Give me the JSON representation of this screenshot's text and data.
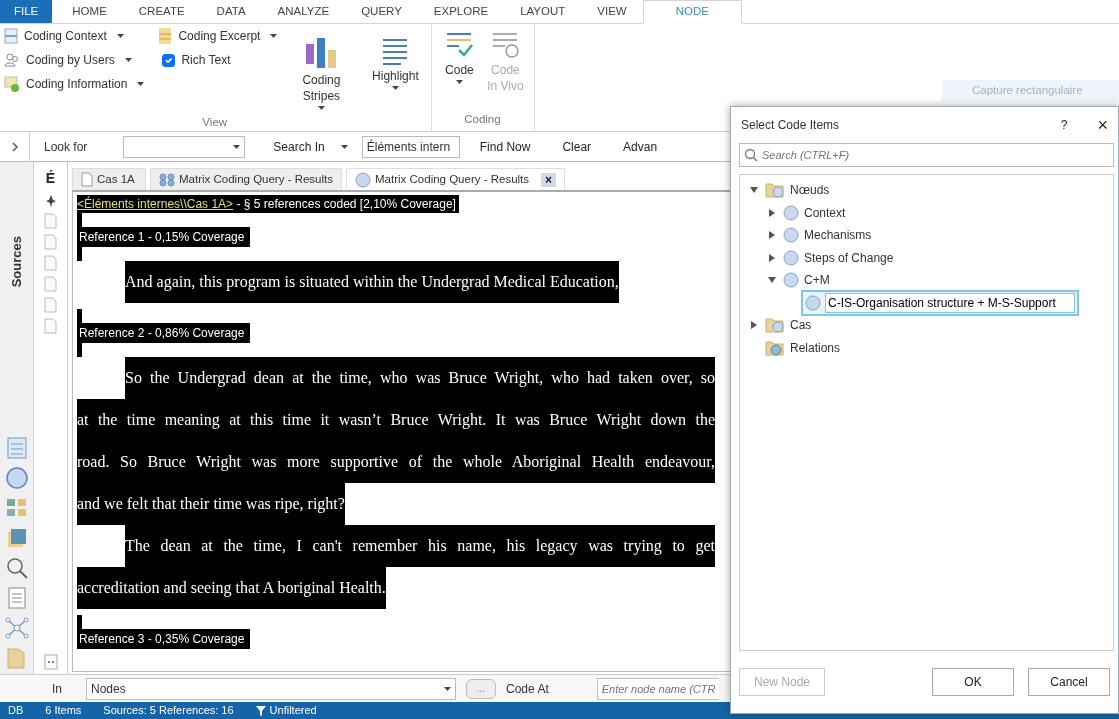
{
  "ribbon_tabs": [
    {
      "label": "FILE",
      "kind": "file",
      "selected": false
    },
    {
      "label": "HOME",
      "kind": "tab",
      "selected": false
    },
    {
      "label": "CREATE",
      "kind": "tab",
      "selected": false
    },
    {
      "label": "DATA",
      "kind": "tab",
      "selected": false
    },
    {
      "label": "ANALYZE",
      "kind": "tab",
      "selected": false
    },
    {
      "label": "QUERY",
      "kind": "tab",
      "selected": false
    },
    {
      "label": "EXPLORE",
      "kind": "tab",
      "selected": false
    },
    {
      "label": "LAYOUT",
      "kind": "tab",
      "selected": false
    },
    {
      "label": "VIEW",
      "kind": "tab",
      "selected": false
    },
    {
      "label": "NODE",
      "kind": "tab",
      "selected": true
    }
  ],
  "ribbon": {
    "view_group": {
      "label": "View",
      "small_items": [
        {
          "label": "Coding Context",
          "kind": "dropdown"
        },
        {
          "label": "Coding by Users",
          "kind": "dropdown"
        },
        {
          "label": "Coding Information",
          "kind": "dropdown"
        },
        {
          "label": "Coding Excerpt",
          "kind": "dropdown"
        },
        {
          "label": "Rich Text",
          "kind": "checkbox",
          "checked": true
        }
      ],
      "large_items": [
        {
          "label": "Coding Stripes",
          "kind": "dropdown"
        },
        {
          "label": "Highlight",
          "kind": "dropdown"
        }
      ]
    },
    "coding_group": {
      "label": "Coding",
      "large_items": [
        {
          "label": "Code",
          "kind": "dropdown",
          "disabled": false
        },
        {
          "label": "Code In Vivo",
          "kind": "button",
          "disabled": true
        }
      ]
    }
  },
  "capture_hint": "Capture rectangulaire",
  "find_bar": {
    "look_for": "Look for",
    "search_in": "Search In",
    "search_in_value": "Éléments intern",
    "buttons": [
      "Find Now",
      "Clear",
      "Advan"
    ]
  },
  "sidebar": {
    "label": "Sources"
  },
  "list_header": "É",
  "doc_tabs": [
    {
      "label": "Cas 1A",
      "selected": false
    },
    {
      "label": "Matrix Coding Query - Results",
      "selected": false
    },
    {
      "label": "Matrix Coding Query - Results",
      "selected": true,
      "close": "×"
    }
  ],
  "document": {
    "source_link": "<Éléments internes\\\\Cas 1A>",
    "summary": " - § 5 references coded  [2,10% Coverage]",
    "references": [
      {
        "label": "Reference 1 - 0,15% Coverage",
        "paragraphs": [
          {
            "lines": [
              "And again, this program is situated within the Undergrad Medical Education,"
            ]
          }
        ]
      },
      {
        "label": "Reference 2 - 0,86% Coverage",
        "paragraphs": [
          {
            "lines": [
              "So the Undergrad dean at the time, who was Bruce Wright, who had taken over, so",
              "at the time meaning at this time it wasn’t Bruce Wright. It was Bruce Wright down the",
              "road. So Bruce Wright was more supportive of the whole Aboriginal Health endeavour,",
              "and we felt that their time was ripe, right?"
            ]
          },
          {
            "lines": [
              "The dean at the time, I can't remember his name, his legacy was trying to get",
              "accreditation and seeing that A boriginal Health."
            ]
          }
        ]
      },
      {
        "label": "Reference 3 - 0,35% Coverage"
      }
    ]
  },
  "code_bar": {
    "in_label": "In",
    "in_value": "Nodes",
    "browse": "...",
    "code_at": "Code At",
    "placeholder": "Enter node name (CTR"
  },
  "status_bar": [
    "DB",
    "6 Items",
    "Sources: 5  References: 16",
    "Unfiltered"
  ],
  "dialog": {
    "title": "Select Code Items",
    "help": "?",
    "close": "×",
    "search_placeholder": "Search (CTRL+F)",
    "tree": [
      {
        "label": "Nœuds",
        "kind": "folder",
        "expanded": true,
        "children": [
          {
            "label": "Context",
            "kind": "node",
            "expanded": false
          },
          {
            "label": "Mechanisms",
            "kind": "node",
            "expanded": false
          },
          {
            "label": "Steps of Change",
            "kind": "node",
            "expanded": false
          },
          {
            "label": "C+M",
            "kind": "node",
            "expanded": true,
            "children": [
              {
                "label": "C-IS-Organisation structure + M-S-Support",
                "kind": "node",
                "editing": true
              }
            ]
          }
        ]
      },
      {
        "label": "Cas",
        "kind": "folder",
        "expanded": false
      },
      {
        "label": "Relations",
        "kind": "relations"
      }
    ],
    "buttons": [
      {
        "label": "New Node",
        "disabled": true
      },
      {
        "label": "OK",
        "disabled": false
      },
      {
        "label": "Cancel",
        "disabled": false
      }
    ]
  }
}
